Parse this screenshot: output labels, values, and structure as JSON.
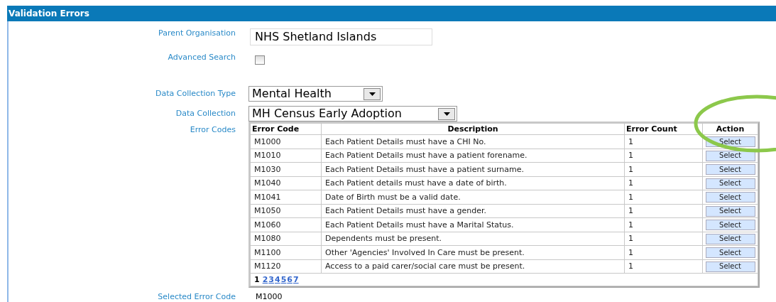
{
  "header": {
    "title": "Validation Errors"
  },
  "form": {
    "parent_organisation": {
      "label": "Parent Organisation",
      "value": "NHS Shetland Islands"
    },
    "advanced_search": {
      "label": "Advanced Search",
      "checked": false
    },
    "data_collection_type": {
      "label": "Data Collection Type",
      "value": "Mental Health"
    },
    "data_collection": {
      "label": "Data Collection",
      "value": "MH Census Early Adoption"
    },
    "error_codes_label": "Error Codes",
    "selected_error_code": {
      "label": "Selected Error Code",
      "value": "M1000"
    }
  },
  "table": {
    "columns": [
      "Error Code",
      "Description",
      "Error Count",
      "Action"
    ],
    "rows": [
      {
        "code": "M1000",
        "description": "Each Patient Details must have a CHI No.",
        "count": "1",
        "action": "Select"
      },
      {
        "code": "M1010",
        "description": "Each Patient Details must have a patient forename.",
        "count": "1",
        "action": "Select"
      },
      {
        "code": "M1030",
        "description": "Each Patient Details must have a patient surname.",
        "count": "1",
        "action": "Select"
      },
      {
        "code": "M1040",
        "description": "Each Patient details must have a date of birth.",
        "count": "1",
        "action": "Select"
      },
      {
        "code": "M1041",
        "description": "Date of Birth must be a valid date.",
        "count": "1",
        "action": "Select"
      },
      {
        "code": "M1050",
        "description": "Each Patient Details must have a gender.",
        "count": "1",
        "action": "Select"
      },
      {
        "code": "M1060",
        "description": "Each Patient Details must have a Marital Status.",
        "count": "1",
        "action": "Select"
      },
      {
        "code": "M1080",
        "description": "Dependents must be present.",
        "count": "1",
        "action": "Select"
      },
      {
        "code": "M1100",
        "description": "Other 'Agencies' Involved In Care must be present.",
        "count": "1",
        "action": "Select"
      },
      {
        "code": "M1120",
        "description": "Access to a paid carer/social care must be present.",
        "count": "1",
        "action": "Select"
      }
    ],
    "pages": [
      {
        "label": "1",
        "selected": true
      },
      {
        "label": "2",
        "selected": false
      },
      {
        "label": "3",
        "selected": false
      },
      {
        "label": "4",
        "selected": false
      },
      {
        "label": "5",
        "selected": false
      },
      {
        "label": "6",
        "selected": false
      },
      {
        "label": "7",
        "selected": false
      }
    ]
  }
}
